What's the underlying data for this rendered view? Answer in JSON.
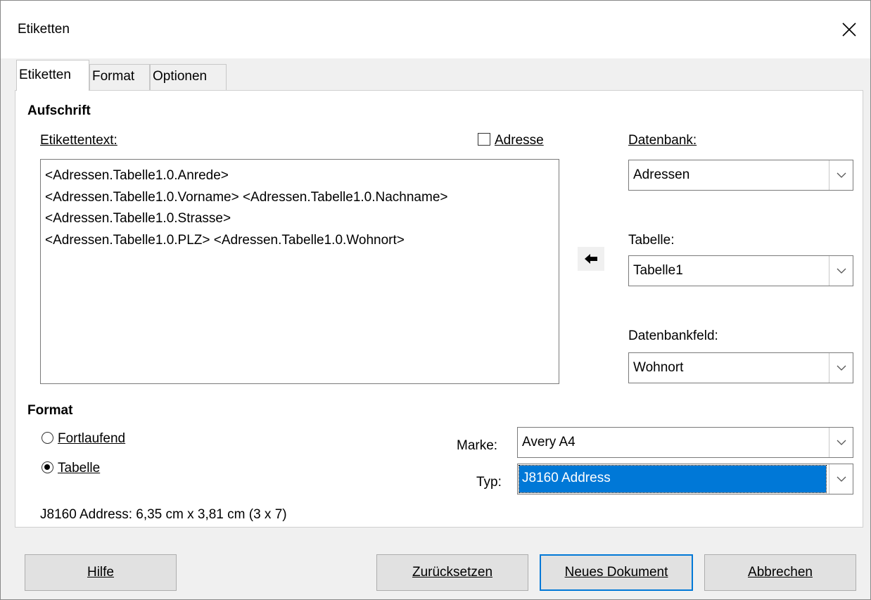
{
  "window": {
    "title": "Etiketten"
  },
  "tabs": [
    {
      "label": "Etiketten",
      "active": true
    },
    {
      "label": "Format",
      "active": false
    },
    {
      "label": "Optionen",
      "active": false
    }
  ],
  "aufschrift": {
    "heading": "Aufschrift",
    "label_text_label": "Etikettentext:",
    "adresse_label": "Adresse",
    "adresse_checked": false,
    "lines": [
      "<Adressen.Tabelle1.0.Anrede>",
      "<Adressen.Tabelle1.0.Vorname> <Adressen.Tabelle1.0.Nachname>",
      "<Adressen.Tabelle1.0.Strasse>",
      "<Adressen.Tabelle1.0.PLZ> <Adressen.Tabelle1.0.Wohnort>"
    ]
  },
  "database": {
    "datenbank_label": "Datenbank:",
    "datenbank_value": "Adressen",
    "tabelle_label": "Tabelle:",
    "tabelle_value": "Tabelle1",
    "feld_label": "Datenbankfeld:",
    "feld_value": "Wohnort",
    "insert_icon": "arrow-left-icon"
  },
  "format": {
    "heading": "Format",
    "option_continuous": "Fortlaufend",
    "option_table": "Tabelle",
    "selected_option": "Tabelle",
    "marke_label": "Marke:",
    "marke_value": "Avery A4",
    "typ_label": "Typ:",
    "typ_value": "J8160 Address",
    "info": "J8160 Address: 6,35 cm x 3,81 cm (3 x 7)"
  },
  "buttons": {
    "help": "Hilfe",
    "reset": "Zurücksetzen",
    "new_document": "Neues Dokument",
    "cancel": "Abbrechen"
  },
  "colors": {
    "accent": "#0078d7"
  }
}
